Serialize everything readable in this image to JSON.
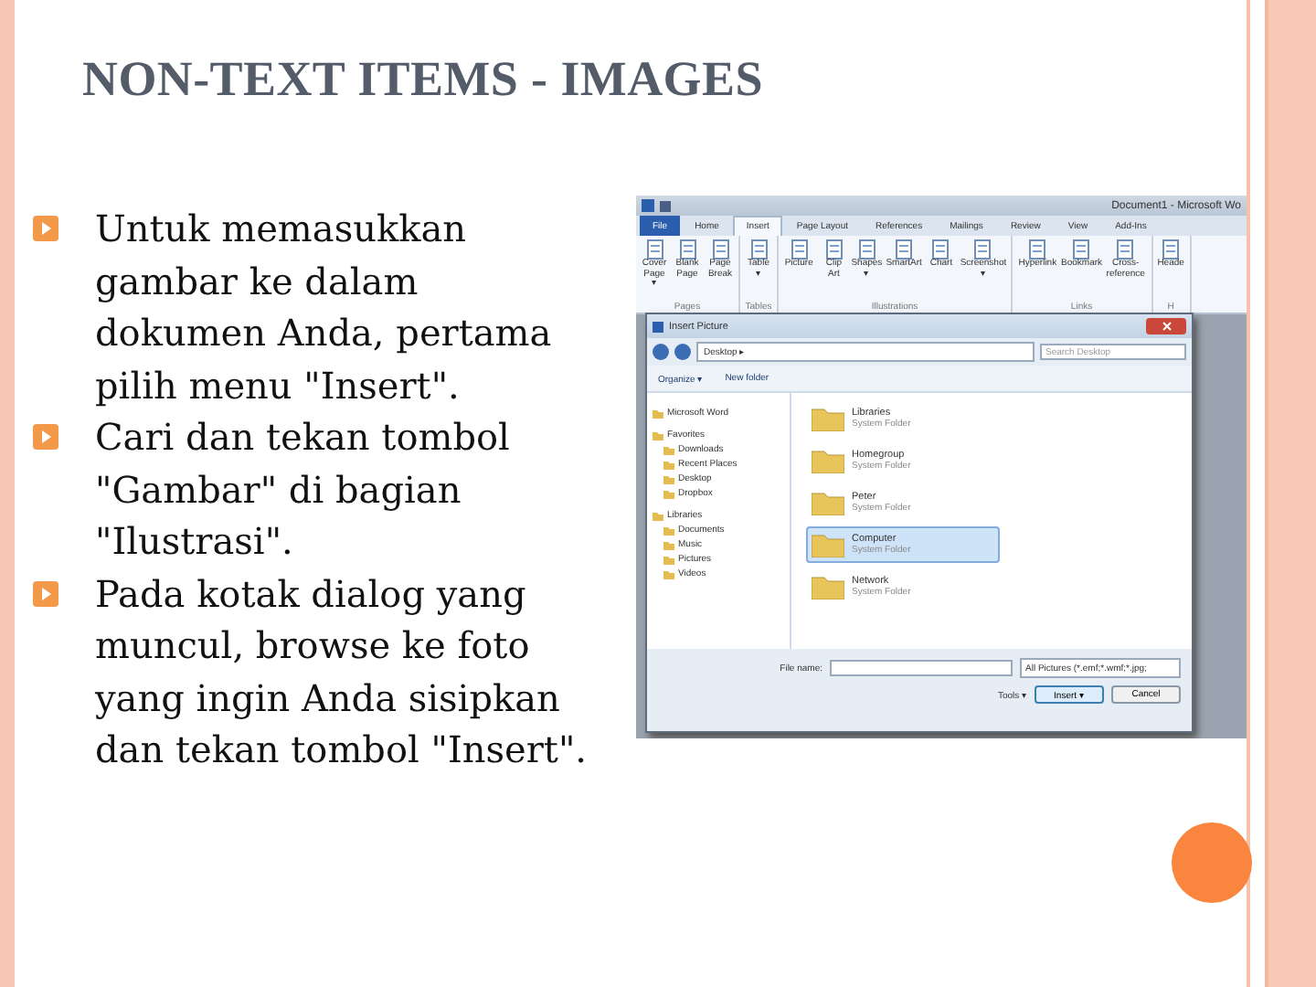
{
  "title": "NON-TEXT ITEMS - IMAGES",
  "bullets": [
    {
      "text": "Untuk memasukkan gambar ke dalam dokumen Anda, pertama pilih menu \"Insert\"."
    },
    {
      "text": "Cari dan tekan tombol \"Gambar\" di bagian \"Ilustrasi\"."
    },
    {
      "text": "Pada kotak dialog yang muncul, browse ke foto yang ingin Anda sisipkan dan tekan tombol \"Insert\"."
    }
  ],
  "screenshot": {
    "window_title": "Document1 - Microsoft Wo",
    "ribbon_tabs": [
      {
        "label": "File",
        "selected": false,
        "kind": "file"
      },
      {
        "label": "Home",
        "selected": false,
        "kind": "tab"
      },
      {
        "label": "Insert",
        "selected": true,
        "kind": "tab"
      },
      {
        "label": "Page Layout",
        "selected": false,
        "kind": "tab"
      },
      {
        "label": "References",
        "selected": false,
        "kind": "tab"
      },
      {
        "label": "Mailings",
        "selected": false,
        "kind": "tab"
      },
      {
        "label": "Review",
        "selected": false,
        "kind": "tab"
      },
      {
        "label": "View",
        "selected": false,
        "kind": "tab"
      },
      {
        "label": "Add-Ins",
        "selected": false,
        "kind": "tab"
      }
    ],
    "ribbon_groups": [
      {
        "label": "Pages",
        "buttons": [
          "Cover Page ▾",
          "Blank Page",
          "Page Break"
        ]
      },
      {
        "label": "Tables",
        "buttons": [
          "Table ▾"
        ]
      },
      {
        "label": "Illustrations",
        "buttons": [
          "Picture",
          "Clip Art",
          "Shapes ▾",
          "SmartArt",
          "Chart",
          "Screenshot ▾"
        ]
      },
      {
        "label": "Links",
        "buttons": [
          "Hyperlink",
          "Bookmark",
          "Cross-reference"
        ]
      },
      {
        "label": "H",
        "buttons": [
          "Heade"
        ]
      }
    ],
    "dialog": {
      "title": "Insert Picture",
      "breadcrumb": "Desktop ▸",
      "search_placeholder": "Search Desktop",
      "toolbar": [
        "Organize ▾",
        "New folder"
      ],
      "nav": [
        {
          "label": "Microsoft Word"
        },
        {
          "label": "Favorites",
          "children": [
            {
              "label": "Downloads"
            },
            {
              "label": "Recent Places"
            },
            {
              "label": "Desktop"
            },
            {
              "label": "Dropbox"
            }
          ]
        },
        {
          "label": "Libraries",
          "children": [
            {
              "label": "Documents"
            },
            {
              "label": "Music"
            },
            {
              "label": "Pictures"
            },
            {
              "label": "Videos"
            }
          ]
        }
      ],
      "items": [
        {
          "name": "Libraries",
          "subtitle": "System Folder",
          "selected": false
        },
        {
          "name": "Homegroup",
          "subtitle": "System Folder",
          "selected": false
        },
        {
          "name": "Peter",
          "subtitle": "System Folder",
          "selected": false
        },
        {
          "name": "Computer",
          "subtitle": "System Folder",
          "selected": true
        },
        {
          "name": "Network",
          "subtitle": "System Folder",
          "selected": false
        }
      ],
      "file_name_label": "File name:",
      "filter": "All Pictures (*.emf;*.wmf;*.jpg;",
      "tools": "Tools ▾",
      "buttons": [
        {
          "label": "Insert ▾",
          "primary": true
        },
        {
          "label": "Cancel",
          "primary": false
        }
      ]
    }
  }
}
